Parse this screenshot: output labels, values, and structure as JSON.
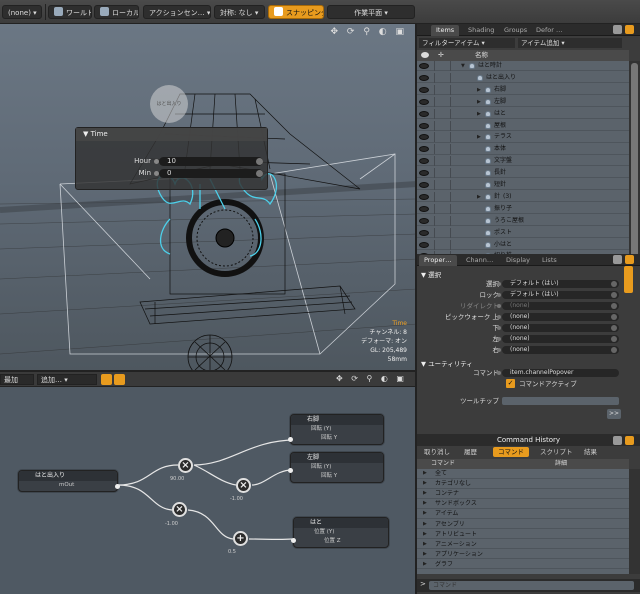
{
  "toolbar": {
    "none_label": "(none)",
    "world_label": "ワールド",
    "local_label": "ローカル",
    "action_center_label": "アクションセン…",
    "symmetry_label": "対称: なし",
    "snapping_label": "スナッピング",
    "work_plane_label": "作業平面",
    "accent": "#e89b1e"
  },
  "viewport": {
    "tools": "✥ ⟳ ⚲ ◐ ▣",
    "ghost_label": "はと出入り",
    "time_panel": {
      "title": "Time",
      "fields": [
        {
          "label": "Hour",
          "value": "10"
        },
        {
          "label": "Min",
          "value": "0"
        }
      ]
    },
    "info": {
      "time_label": "Time",
      "channel": "チャンネル: 8",
      "deform": "デフォーマ: オン",
      "gl": "GL: 205,489",
      "focal": "58mm"
    }
  },
  "schematic": {
    "left_drop": "最加",
    "add_drop": "追加…",
    "tools": "✥ ⟳ ⚲ ◐ ▣",
    "nodes": {
      "source": {
        "title": "はと出入り",
        "row": "mOut"
      },
      "right_leg": {
        "title": "右脚",
        "row1": "回転 (Y)",
        "row2": "回転 Y"
      },
      "left_leg": {
        "title": "左脚",
        "row1": "回転 (Y)",
        "row2": "回転 Y"
      },
      "dove": {
        "title": "はと",
        "row1": "位置 (Y)",
        "row2": "位置 Z"
      }
    },
    "op_labels": [
      "90.00",
      "-1.00",
      "-1.00",
      "0.5"
    ]
  },
  "items_panel": {
    "tabs": [
      "Items",
      "Shading",
      "Groups",
      "Defor …"
    ],
    "filter_label": "フィルターアイテム",
    "add_item_label": "アイテム追加",
    "name_header": "名称",
    "items": [
      {
        "name": "はと時計",
        "indent": 1,
        "arrow": "▼"
      },
      {
        "name": "はと出入り",
        "indent": 2,
        "arrow": ""
      },
      {
        "name": "右脚",
        "indent": 3,
        "arrow": "▶"
      },
      {
        "name": "左脚",
        "indent": 3,
        "arrow": "▶"
      },
      {
        "name": "はと",
        "indent": 3,
        "arrow": "▶"
      },
      {
        "name": "屋根",
        "indent": 3,
        "arrow": ""
      },
      {
        "name": "テラス",
        "indent": 3,
        "arrow": "▶"
      },
      {
        "name": "本体",
        "indent": 3,
        "arrow": ""
      },
      {
        "name": "文字盤",
        "indent": 3,
        "arrow": ""
      },
      {
        "name": "長針",
        "indent": 3,
        "arrow": ""
      },
      {
        "name": "短針",
        "indent": 3,
        "arrow": ""
      },
      {
        "name": "針",
        "indent": 3,
        "arrow": "▶",
        "suffix": "(3)"
      },
      {
        "name": "振り子",
        "indent": 3,
        "arrow": ""
      },
      {
        "name": "うろこ屋根",
        "indent": 3,
        "arrow": ""
      },
      {
        "name": "ポスト",
        "indent": 3,
        "arrow": ""
      },
      {
        "name": "小はと",
        "indent": 3,
        "arrow": ""
      },
      {
        "name": "切り株",
        "indent": 3,
        "arrow": ""
      }
    ]
  },
  "props_panel": {
    "tabs": [
      "Proper…",
      "Chann…",
      "Display",
      "Lists"
    ],
    "section1": "選択",
    "rows": [
      {
        "label": "選択",
        "value": "デフォルト (はい)",
        "dim": false
      },
      {
        "label": "ロック",
        "value": "デフォルト (はい)",
        "dim": false
      },
      {
        "label": "リダイレクト",
        "value": "(none)",
        "dim": true
      },
      {
        "label": "ピックウォーク 上",
        "value": "(none)",
        "dim": false
      },
      {
        "label": "下",
        "value": "(none)",
        "dim": false
      },
      {
        "label": "左",
        "value": "(none)",
        "dim": false
      },
      {
        "label": "右",
        "value": "(none)",
        "dim": false
      }
    ],
    "section2": "ユーティリティ",
    "command_label": "コマンド",
    "command_value": "item.channelPopover",
    "command_active_label": "コマンドアクティブ",
    "tooltip_label": "ツールチップ",
    "more_btn": ">>"
  },
  "history_panel": {
    "title": "Command History",
    "tabs": [
      "取り消し",
      "履歴",
      "コマンド",
      "スクリプト",
      "結果"
    ],
    "active_tab": 2,
    "col_command": "コマンド",
    "col_detail": "詳細",
    "entries": [
      "全て",
      "カテゴリなし",
      "コンテナ",
      "サンドボックス",
      "アイテム",
      "アセンブリ",
      "アトリビュート",
      "アニメーション",
      "アプリケーション",
      "グラフ"
    ],
    "input_placeholder": "コマンド"
  }
}
